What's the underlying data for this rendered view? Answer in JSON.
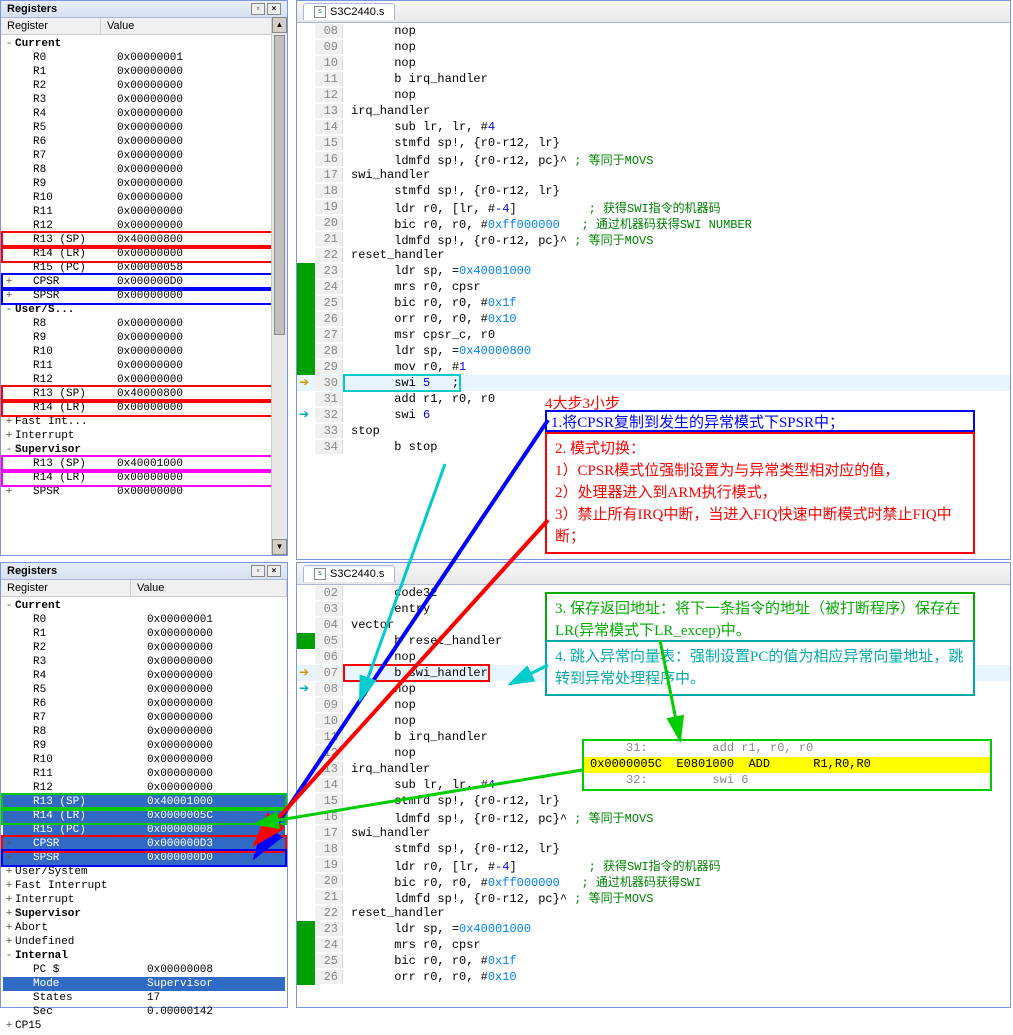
{
  "panel1": {
    "title": "Registers",
    "header_reg": "Register",
    "header_val": "Value",
    "nodes": [
      {
        "exp": "-",
        "ind": 0,
        "name": "Current",
        "val": "",
        "group": true
      },
      {
        "exp": "",
        "ind": 1,
        "name": "R0",
        "val": "0x00000001"
      },
      {
        "exp": "",
        "ind": 1,
        "name": "R1",
        "val": "0x00000000"
      },
      {
        "exp": "",
        "ind": 1,
        "name": "R2",
        "val": "0x00000000"
      },
      {
        "exp": "",
        "ind": 1,
        "name": "R3",
        "val": "0x00000000"
      },
      {
        "exp": "",
        "ind": 1,
        "name": "R4",
        "val": "0x00000000"
      },
      {
        "exp": "",
        "ind": 1,
        "name": "R5",
        "val": "0x00000000"
      },
      {
        "exp": "",
        "ind": 1,
        "name": "R6",
        "val": "0x00000000"
      },
      {
        "exp": "",
        "ind": 1,
        "name": "R7",
        "val": "0x00000000"
      },
      {
        "exp": "",
        "ind": 1,
        "name": "R8",
        "val": "0x00000000"
      },
      {
        "exp": "",
        "ind": 1,
        "name": "R9",
        "val": "0x00000000"
      },
      {
        "exp": "",
        "ind": 1,
        "name": "R10",
        "val": "0x00000000"
      },
      {
        "exp": "",
        "ind": 1,
        "name": "R11",
        "val": "0x00000000"
      },
      {
        "exp": "",
        "ind": 1,
        "name": "R12",
        "val": "0x00000000"
      },
      {
        "exp": "",
        "ind": 1,
        "name": "R13 (SP)",
        "val": "0x40000800",
        "box": "red"
      },
      {
        "exp": "",
        "ind": 1,
        "name": "R14 (LR)",
        "val": "0x00000000",
        "box": "red"
      },
      {
        "exp": "",
        "ind": 1,
        "name": "R15 (PC)",
        "val": "0x00000058"
      },
      {
        "exp": "+",
        "ind": 1,
        "name": "CPSR",
        "val": "0x000000D0",
        "box": "blue"
      },
      {
        "exp": "+",
        "ind": 1,
        "name": "SPSR",
        "val": "0x00000000",
        "box": "blue"
      },
      {
        "exp": "-",
        "ind": 0,
        "name": "User/S...",
        "val": "",
        "group": true
      },
      {
        "exp": "",
        "ind": 1,
        "name": "R8",
        "val": "0x00000000"
      },
      {
        "exp": "",
        "ind": 1,
        "name": "R9",
        "val": "0x00000000"
      },
      {
        "exp": "",
        "ind": 1,
        "name": "R10",
        "val": "0x00000000"
      },
      {
        "exp": "",
        "ind": 1,
        "name": "R11",
        "val": "0x00000000"
      },
      {
        "exp": "",
        "ind": 1,
        "name": "R12",
        "val": "0x00000000"
      },
      {
        "exp": "",
        "ind": 1,
        "name": "R13 (SP)",
        "val": "0x40000800",
        "box": "red"
      },
      {
        "exp": "",
        "ind": 1,
        "name": "R14 (LR)",
        "val": "0x00000000",
        "box": "red"
      },
      {
        "exp": "+",
        "ind": 0,
        "name": "Fast Int...",
        "val": ""
      },
      {
        "exp": "+",
        "ind": 0,
        "name": "Interrupt",
        "val": ""
      },
      {
        "exp": "-",
        "ind": 0,
        "name": "Supervisor",
        "val": "",
        "group": true
      },
      {
        "exp": "",
        "ind": 1,
        "name": "R13 (SP)",
        "val": "0x40001000",
        "box": "magenta2"
      },
      {
        "exp": "",
        "ind": 1,
        "name": "R14 (LR)",
        "val": "0x00000000",
        "box": "magenta2"
      },
      {
        "exp": "+",
        "ind": 1,
        "name": "SPSR",
        "val": "0x00000000"
      }
    ]
  },
  "panel2": {
    "title": "Registers",
    "header_reg": "Register",
    "header_val": "Value",
    "nodes": [
      {
        "exp": "-",
        "ind": 0,
        "name": "Current",
        "val": "",
        "group": true
      },
      {
        "exp": "",
        "ind": 1,
        "name": "R0",
        "val": "0x00000001"
      },
      {
        "exp": "",
        "ind": 1,
        "name": "R1",
        "val": "0x00000000"
      },
      {
        "exp": "",
        "ind": 1,
        "name": "R2",
        "val": "0x00000000"
      },
      {
        "exp": "",
        "ind": 1,
        "name": "R3",
        "val": "0x00000000"
      },
      {
        "exp": "",
        "ind": 1,
        "name": "R4",
        "val": "0x00000000"
      },
      {
        "exp": "",
        "ind": 1,
        "name": "R5",
        "val": "0x00000000"
      },
      {
        "exp": "",
        "ind": 1,
        "name": "R6",
        "val": "0x00000000"
      },
      {
        "exp": "",
        "ind": 1,
        "name": "R7",
        "val": "0x00000000"
      },
      {
        "exp": "",
        "ind": 1,
        "name": "R8",
        "val": "0x00000000"
      },
      {
        "exp": "",
        "ind": 1,
        "name": "R9",
        "val": "0x00000000"
      },
      {
        "exp": "",
        "ind": 1,
        "name": "R10",
        "val": "0x00000000"
      },
      {
        "exp": "",
        "ind": 1,
        "name": "R11",
        "val": "0x00000000"
      },
      {
        "exp": "",
        "ind": 1,
        "name": "R12",
        "val": "0x00000000"
      },
      {
        "exp": "",
        "ind": 1,
        "name": "R13 (SP)",
        "val": "0x40001000",
        "sel": true,
        "box": "green"
      },
      {
        "exp": "",
        "ind": 1,
        "name": "R14 (LR)",
        "val": "0x0000005C",
        "sel": true,
        "box": "green"
      },
      {
        "exp": "",
        "ind": 1,
        "name": "R15 (PC)",
        "val": "0x00000008",
        "sel": true
      },
      {
        "exp": "+",
        "ind": 1,
        "name": "CPSR",
        "val": "0x000000D3",
        "sel": true,
        "box": "red"
      },
      {
        "exp": "+",
        "ind": 1,
        "name": "SPSR",
        "val": "0x000000D0",
        "sel": true,
        "box": "blue"
      },
      {
        "exp": "+",
        "ind": 0,
        "name": "User/System",
        "val": ""
      },
      {
        "exp": "+",
        "ind": 0,
        "name": "Fast Interrupt",
        "val": ""
      },
      {
        "exp": "+",
        "ind": 0,
        "name": "Interrupt",
        "val": ""
      },
      {
        "exp": "+",
        "ind": 0,
        "name": "Supervisor",
        "val": "",
        "group": true
      },
      {
        "exp": "+",
        "ind": 0,
        "name": "Abort",
        "val": ""
      },
      {
        "exp": "+",
        "ind": 0,
        "name": "Undefined",
        "val": ""
      },
      {
        "exp": "-",
        "ind": 0,
        "name": "Internal",
        "val": "",
        "group": true
      },
      {
        "exp": "",
        "ind": 1,
        "name": "PC $",
        "val": "0x00000008"
      },
      {
        "exp": "",
        "ind": 1,
        "name": "Mode",
        "val": "Supervisor",
        "sel": true
      },
      {
        "exp": "",
        "ind": 1,
        "name": "States",
        "val": "17"
      },
      {
        "exp": "",
        "ind": 1,
        "name": "Sec",
        "val": "0.00000142"
      },
      {
        "exp": "+",
        "ind": 0,
        "name": "CP15",
        "val": ""
      }
    ]
  },
  "code1": {
    "tab": "S3C2440.s",
    "lines": [
      {
        "n": "08",
        "m": "",
        "t": "      nop"
      },
      {
        "n": "09",
        "m": "",
        "t": "      nop"
      },
      {
        "n": "10",
        "m": "",
        "t": "      nop"
      },
      {
        "n": "11",
        "m": "",
        "t": "      b irq_handler"
      },
      {
        "n": "12",
        "m": "",
        "t": "      nop"
      },
      {
        "n": "13",
        "m": "",
        "t": "irq_handler"
      },
      {
        "n": "14",
        "m": "",
        "t": "      sub lr, lr, #",
        "num": "4"
      },
      {
        "n": "15",
        "m": "",
        "t": "      stmfd sp!, {r0-r12, lr}"
      },
      {
        "n": "16",
        "m": "",
        "t": "      ldmfd sp!, {r0-r12, pc}^ ",
        "c": "; 等同于MOVS"
      },
      {
        "n": "17",
        "m": "",
        "t": "swi_handler"
      },
      {
        "n": "18",
        "m": "",
        "t": "      stmfd sp!, {r0-r12, lr}"
      },
      {
        "n": "19",
        "m": "",
        "t": "      ldr r0, [lr, #",
        "num": "-4",
        "t2": "]          ",
        "c": "; 获得SWI指令的机器码"
      },
      {
        "n": "20",
        "m": "",
        "t": "      bic r0, r0, #",
        "hex": "0xff000000",
        "t2": "   ",
        "c": "; 通过机器码获得SWI NUMBER"
      },
      {
        "n": "21",
        "m": "",
        "t": "      ldmfd sp!, {r0-r12, pc}^ ",
        "c": "; 等同于MOVS"
      },
      {
        "n": "22",
        "m": "",
        "t": "reset_handler"
      },
      {
        "n": "23",
        "m": "green",
        "t": "      ldr sp, =",
        "hex": "0x40001000"
      },
      {
        "n": "24",
        "m": "green",
        "t": "      mrs r0, cpsr"
      },
      {
        "n": "25",
        "m": "green",
        "t": "      bic r0, r0, #",
        "hex": "0x1f"
      },
      {
        "n": "26",
        "m": "green",
        "t": "      orr r0, r0, #",
        "hex": "0x10"
      },
      {
        "n": "27",
        "m": "green",
        "t": "      msr cpsr_c, r0"
      },
      {
        "n": "28",
        "m": "green",
        "t": "      ldr sp, =",
        "hex": "0x40000800"
      },
      {
        "n": "29",
        "m": "green",
        "t": "      mov r0, #",
        "num": "1"
      },
      {
        "n": "30",
        "m": "yellow",
        "t": "      swi ",
        "num": "5",
        "t2": "   ;",
        "cursor": true,
        "boxCyan": true
      },
      {
        "n": "31",
        "m": "",
        "t": "      add r1, r0, r0"
      },
      {
        "n": "32",
        "m": "cyan",
        "t": "      swi ",
        "num": "6"
      },
      {
        "n": "33",
        "m": "",
        "t": "stop"
      },
      {
        "n": "34",
        "m": "",
        "t": "      b stop"
      }
    ]
  },
  "code2": {
    "tab": "S3C2440.s",
    "lines": [
      {
        "n": "02",
        "m": "",
        "t": "      code32"
      },
      {
        "n": "03",
        "m": "",
        "t": "      entry"
      },
      {
        "n": "04",
        "m": "",
        "t": "vector"
      },
      {
        "n": "05",
        "m": "green",
        "t": "      b reset_handler"
      },
      {
        "n": "06",
        "m": "",
        "t": "      nop"
      },
      {
        "n": "07",
        "m": "yellow",
        "t": "      b swi_handler",
        "cursor": true,
        "boxRed": true
      },
      {
        "n": "08",
        "m": "cyan",
        "t": "      nop"
      },
      {
        "n": "09",
        "m": "",
        "t": "      nop"
      },
      {
        "n": "10",
        "m": "",
        "t": "      nop"
      },
      {
        "n": "11",
        "m": "",
        "t": "      b irq_handler"
      },
      {
        "n": "12",
        "m": "",
        "t": "      nop"
      },
      {
        "n": "13",
        "m": "",
        "t": "irq_handler"
      },
      {
        "n": "14",
        "m": "",
        "t": "      sub lr, lr, #",
        "num": "4"
      },
      {
        "n": "15",
        "m": "",
        "t": "      stmfd sp!, {r0-r12, lr}"
      },
      {
        "n": "16",
        "m": "",
        "t": "      ldmfd sp!, {r0-r12, pc}^ ",
        "c": "; 等同于MOVS"
      },
      {
        "n": "17",
        "m": "",
        "t": "swi_handler"
      },
      {
        "n": "18",
        "m": "",
        "t": "      stmfd sp!, {r0-r12, lr}"
      },
      {
        "n": "19",
        "m": "",
        "t": "      ldr r0, [lr, #",
        "num": "-4",
        "t2": "]          ",
        "c": "; 获得SWI指令的机器码"
      },
      {
        "n": "20",
        "m": "",
        "t": "      bic r0, r0, #",
        "hex": "0xff000000",
        "t2": "   ",
        "c": "; 通过机器码获得SWI"
      },
      {
        "n": "21",
        "m": "",
        "t": "      ldmfd sp!, {r0-r12, pc}^ ",
        "c": "; 等同于MOVS"
      },
      {
        "n": "22",
        "m": "",
        "t": "reset_handler"
      },
      {
        "n": "23",
        "m": "green",
        "t": "      ldr sp, =",
        "hex": "0x40001000"
      },
      {
        "n": "24",
        "m": "green",
        "t": "      mrs r0, cpsr"
      },
      {
        "n": "25",
        "m": "green",
        "t": "      bic r0, r0, #",
        "hex": "0x1f"
      },
      {
        "n": "26",
        "m": "green",
        "t": "      orr r0, r0, #",
        "hex": "0x10"
      }
    ]
  },
  "anno": {
    "title": "4大步3小步",
    "step1": "1.将CPSR复制到发生的异常模式下SPSR中；",
    "step2_l1": "2. 模式切换：",
    "step2_l2": "     1）CPSR模式位强制设置为与异常类型相对应的值，",
    "step2_l3": "     2）处理器进入到ARM执行模式，",
    "step2_l4": "     3）禁止所有IRQ中断，当进入FIQ快速中断模式时禁止FIQ中断；",
    "step3": "3. 保存返回地址：将下一条指令的地址（被打断程序）保存在LR(异常模式下LR_excep)中。",
    "step4": "4. 跳入异常向量表：强制设置PC的值为相应异常向量地址，跳转到异常处理程序中。"
  },
  "disasm": {
    "r1": "     31:         add r1, r0, r0",
    "r2a": "0x0000005C",
    "r2b": "E0801000",
    "r2c": "ADD",
    "r2d": "R1,R0,R0",
    "r3": "     32:         swi 6"
  }
}
